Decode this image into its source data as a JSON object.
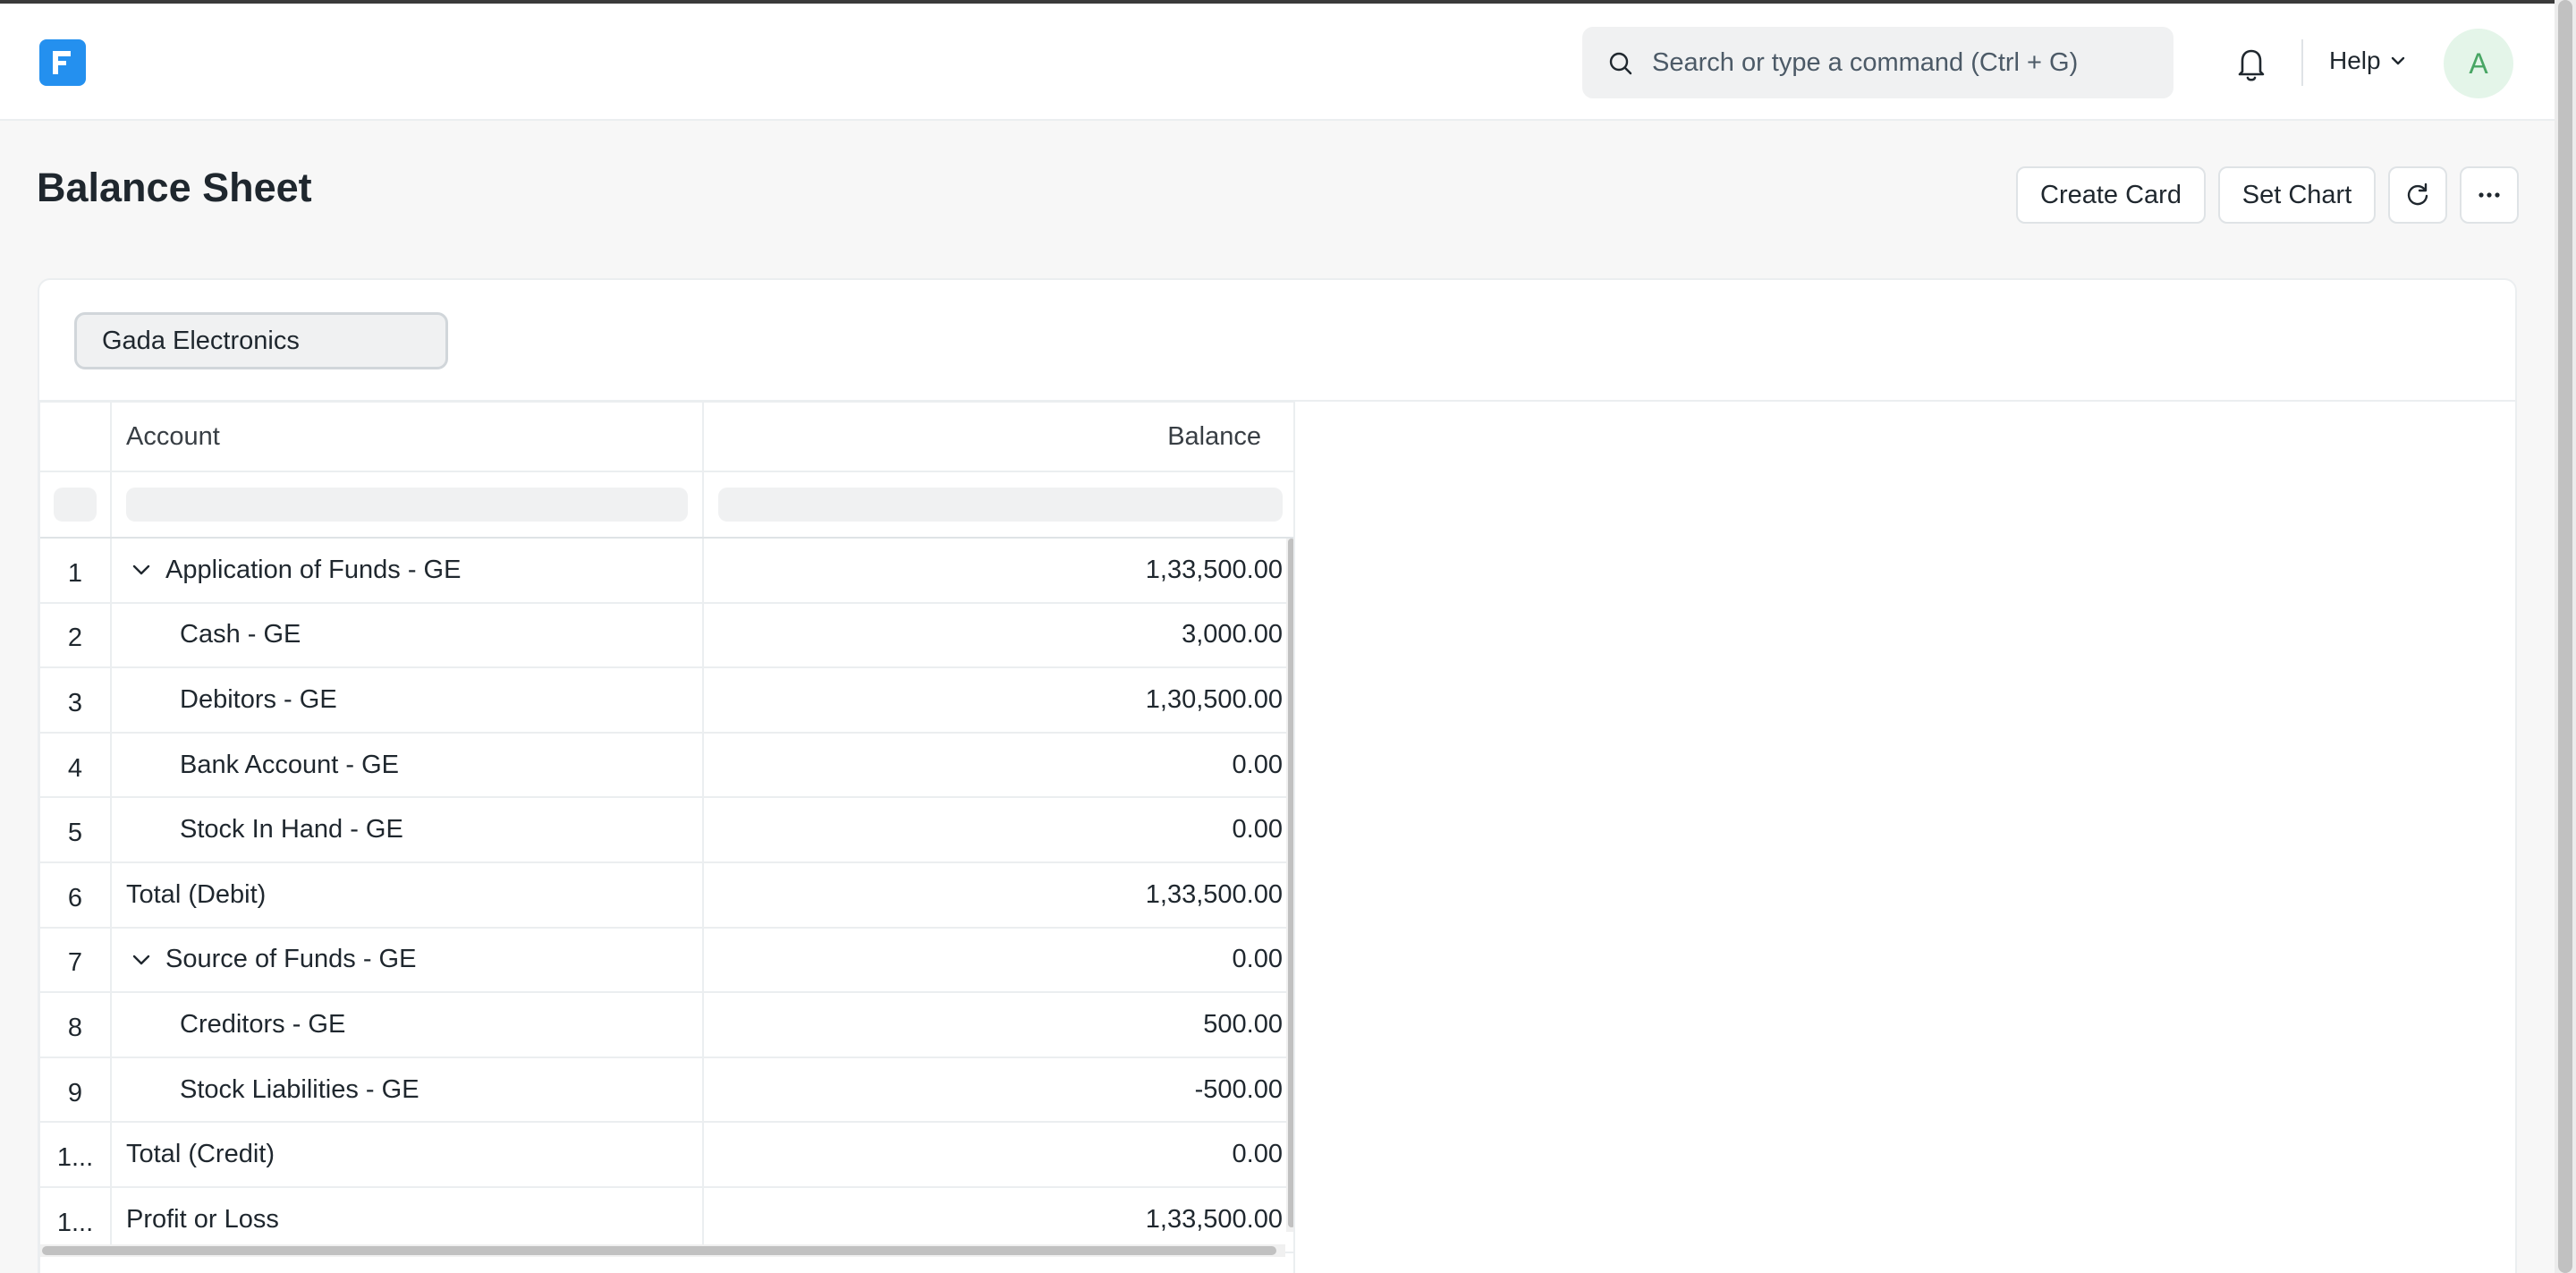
{
  "navbar": {
    "logo_letter": "F",
    "search_placeholder": "Search or type a command (Ctrl + G)",
    "help_label": "Help",
    "avatar_initial": "A"
  },
  "page": {
    "title": "Balance Sheet",
    "actions": {
      "create_card": "Create Card",
      "set_chart": "Set Chart"
    }
  },
  "filters": {
    "company": "Gada Electronics"
  },
  "table": {
    "columns": {
      "account": "Account",
      "balance": "Balance"
    },
    "rows": [
      {
        "idx": "1",
        "account": "Application of Funds - GE",
        "balance": "1,33,500.00"
      },
      {
        "idx": "2",
        "account": "Cash - GE",
        "balance": "3,000.00"
      },
      {
        "idx": "3",
        "account": "Debitors - GE",
        "balance": "1,30,500.00"
      },
      {
        "idx": "4",
        "account": "Bank Account - GE",
        "balance": "0.00"
      },
      {
        "idx": "5",
        "account": "Stock In Hand - GE",
        "balance": "0.00"
      },
      {
        "idx": "6",
        "account": "Total (Debit)",
        "balance": "1,33,500.00"
      },
      {
        "idx": "7",
        "account": "Source of Funds - GE",
        "balance": "0.00"
      },
      {
        "idx": "8",
        "account": "Creditors - GE",
        "balance": "500.00"
      },
      {
        "idx": "9",
        "account": "Stock Liabilities - GE",
        "balance": "-500.00"
      },
      {
        "idx": "1...",
        "account": "Total (Credit)",
        "balance": "0.00"
      },
      {
        "idx": "1...",
        "account": "Profit or Loss",
        "balance": "1,33,500.00"
      }
    ]
  },
  "colors": {
    "brand": "#2490ef",
    "avatar_bg": "#e4f5e9",
    "avatar_text": "#48a664"
  }
}
